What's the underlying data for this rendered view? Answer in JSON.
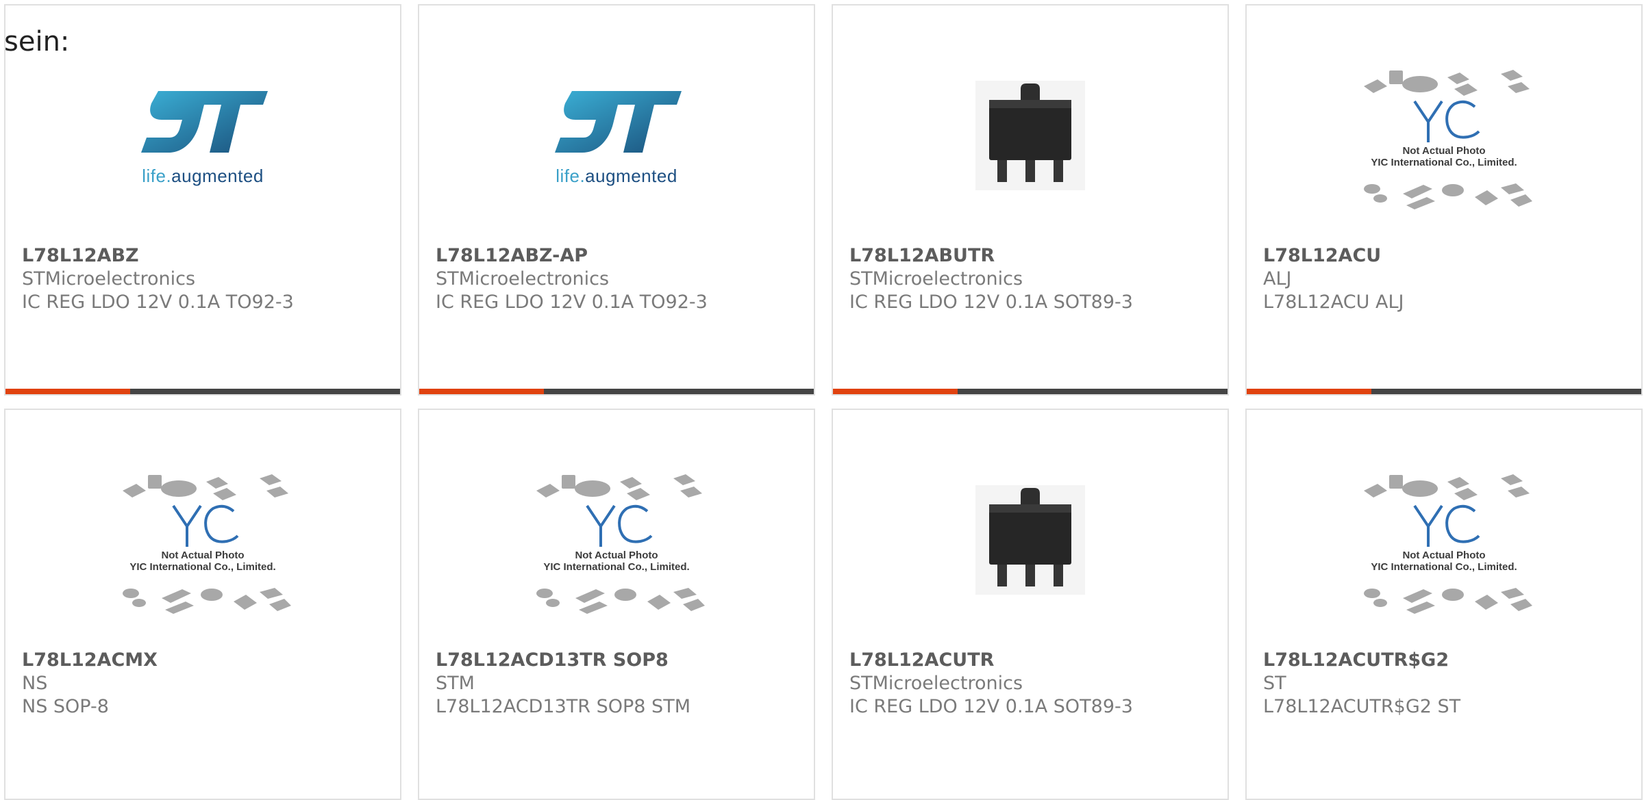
{
  "intro_text": "sein:",
  "st_logo": {
    "tagline_part1": "life.",
    "tagline_part2": "augmented"
  },
  "yic_placeholder": {
    "line1": "Not Actual Photo",
    "line2": "YIC International Co., Limited."
  },
  "colors": {
    "accent": "#e0420f",
    "bar": "#444444",
    "border": "#e0e0e0"
  },
  "products": [
    {
      "part_number": "L78L12ABZ",
      "manufacturer": "STMicroelectronics",
      "description": "IC REG LDO 12V 0.1A TO92-3",
      "image": "st-logo"
    },
    {
      "part_number": "L78L12ABZ-AP",
      "manufacturer": "STMicroelectronics",
      "description": "IC REG LDO 12V 0.1A TO92-3",
      "image": "st-logo"
    },
    {
      "part_number": "L78L12ABUTR",
      "manufacturer": "STMicroelectronics",
      "description": "IC REG LDO 12V 0.1A SOT89-3",
      "image": "sot89-package"
    },
    {
      "part_number": "L78L12ACU",
      "manufacturer": "ALJ",
      "description": "L78L12ACU ALJ",
      "image": "yic-not-actual-photo"
    },
    {
      "part_number": "L78L12ACMX",
      "manufacturer": "NS",
      "description": "NS SOP-8",
      "image": "yic-not-actual-photo"
    },
    {
      "part_number": "L78L12ACD13TR SOP8",
      "manufacturer": "STM",
      "description": "L78L12ACD13TR SOP8 STM",
      "image": "yic-not-actual-photo"
    },
    {
      "part_number": "L78L12ACUTR",
      "manufacturer": "STMicroelectronics",
      "description": "IC REG LDO 12V 0.1A SOT89-3",
      "image": "sot89-package"
    },
    {
      "part_number": "L78L12ACUTR$G2",
      "manufacturer": "ST",
      "description": "L78L12ACUTR$G2 ST",
      "image": "yic-not-actual-photo"
    }
  ]
}
